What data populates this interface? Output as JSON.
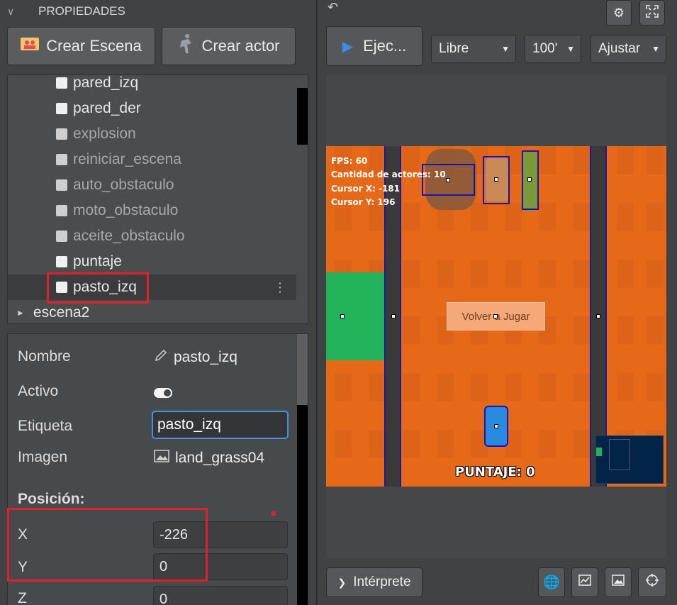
{
  "left_panel": {
    "header": "PROPIEDADES",
    "buttons": [
      {
        "label": "Crear Escena",
        "icon": "scene-icon"
      },
      {
        "label": "Crear actor",
        "icon": "actor-icon"
      }
    ],
    "tree_items": [
      {
        "label": "pared_izq",
        "dim": false
      },
      {
        "label": "pared_der",
        "dim": false
      },
      {
        "label": "explosion",
        "dim": true
      },
      {
        "label": "reiniciar_escena",
        "dim": true
      },
      {
        "label": "auto_obstaculo",
        "dim": true
      },
      {
        "label": "moto_obstaculo",
        "dim": true
      },
      {
        "label": "aceite_obstaculo",
        "dim": true
      },
      {
        "label": "puntaje",
        "dim": false
      },
      {
        "label": "pasto_izq",
        "dim": false,
        "selected": true
      }
    ],
    "scene_item": "escena2",
    "properties": {
      "nombre_label": "Nombre",
      "nombre_value": "pasto_izq",
      "activo_label": "Activo",
      "etiqueta_label": "Etiqueta",
      "etiqueta_value": "pasto_izq",
      "imagen_label": "Imagen",
      "imagen_value": "land_grass04",
      "posicion_title": "Posición:",
      "x_label": "X",
      "x_value": "-226",
      "y_label": "Y",
      "y_value": "0",
      "z_label": "Z",
      "z_value": "0"
    }
  },
  "right_panel": {
    "run_label": "Ejec...",
    "select_mode": "Libre",
    "select_zoom": "100'",
    "select_fit": "Ajustar",
    "game": {
      "fps": "FPS: 60",
      "actors": "Cantidad de actores: 10",
      "cursor_x": "Cursor X: -181",
      "cursor_y": "Cursor Y: 196",
      "replay_button": "Volver a Jugar",
      "score": "PUNTAJE: 0"
    },
    "interpreter_label": "Intérprete"
  },
  "colors": {
    "accent_blue": "#3a8ee6",
    "highlight_red": "#e0202a",
    "stage_orange": "#e6691a",
    "grass_green": "#22b35a"
  }
}
